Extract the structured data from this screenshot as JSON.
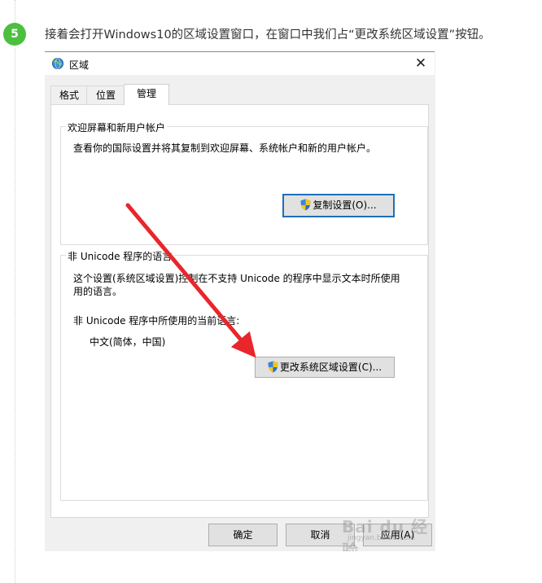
{
  "step": {
    "number": "5",
    "instruction": "接着会打开Windows10的区域设置窗口，在窗口中我们占“更改系统区域设置”按钮。"
  },
  "dialog": {
    "title": "区域",
    "close_glyph": "✕",
    "tabs": [
      "格式",
      "位置",
      "管理"
    ],
    "active_tab": "管理",
    "welcome_group": {
      "title": "欢迎屏幕和新用户帐户",
      "description": "查看你的国际设置并将其复制到欢迎屏幕、系统帐户和新的用户帐户。",
      "copy_button": "复制设置(O)..."
    },
    "unicode_group": {
      "title": "非 Unicode 程序的语言",
      "description_line1": "这个设置(系统区域设置)控制在不支持 Unicode 的程序中显示文本时所使用",
      "description_line2": "用的语言。",
      "current_label": "非 Unicode 程序中所使用的当前语言:",
      "current_value": "中文(简体，中国)",
      "change_button": "更改系统区域设置(C)..."
    },
    "footer": {
      "ok": "确定",
      "cancel": "取消",
      "apply": "应用(A)"
    }
  },
  "watermark": {
    "logo": "Bai du 经验",
    "url": "jingyan.baidu.com"
  },
  "colors": {
    "step_badge": "#4cbf3f",
    "arrow": "#e8262b",
    "focus_border": "#1f6fb8"
  },
  "icons": [
    "globe-icon",
    "close-icon",
    "shield-icon",
    "arrow-annotation"
  ]
}
